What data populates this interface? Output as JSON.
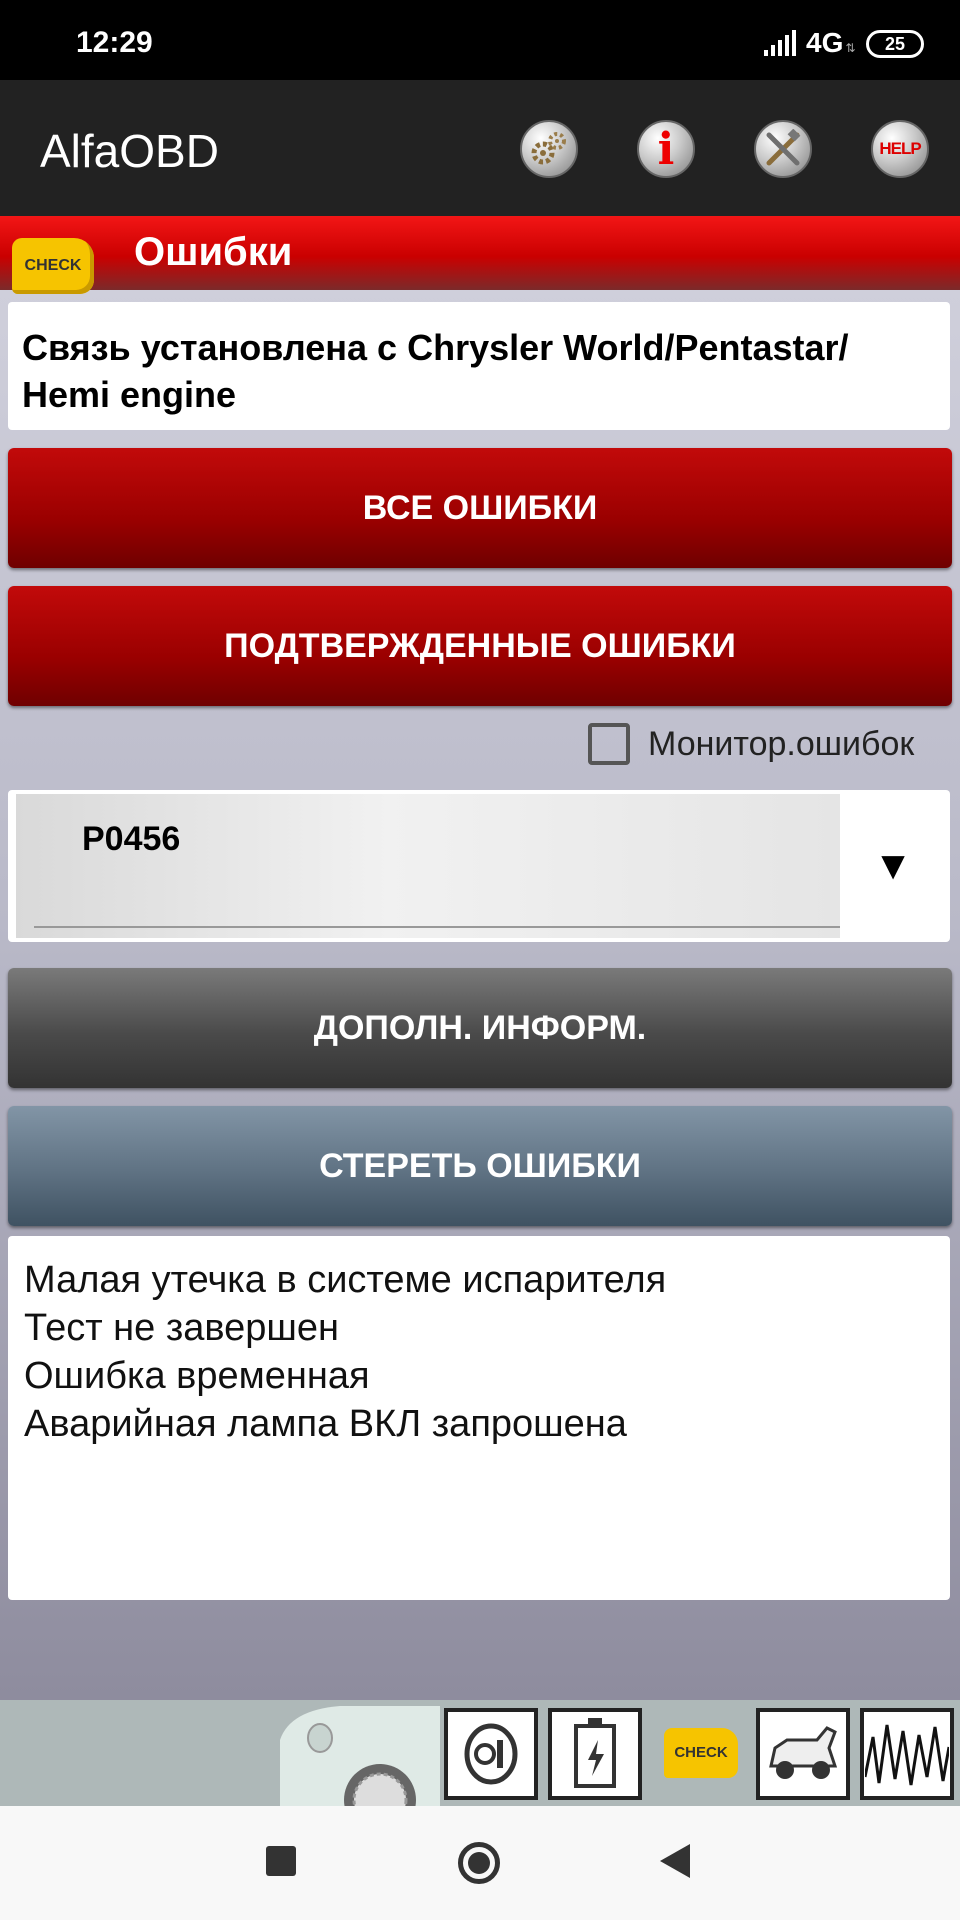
{
  "status_bar": {
    "time": "12:29",
    "network": "4G",
    "battery": "25"
  },
  "app_bar": {
    "title": "AlfaOBD",
    "actions": [
      {
        "icon": "gears-icon"
      },
      {
        "icon": "info-icon",
        "glyph": "i"
      },
      {
        "icon": "tools-icon"
      },
      {
        "icon": "help-icon",
        "glyph": "HELP"
      }
    ]
  },
  "section": {
    "badge": "CHECK",
    "title": "Ошибки"
  },
  "connection_status": "Связь установлена с Chrysler World/Pentastar/ Hemi engine",
  "buttons": {
    "all_errors": "ВСЕ ОШИБКИ",
    "confirmed_errors": "ПОДТВЕРЖДЕННЫЕ ОШИБКИ",
    "more_info": "ДОПОЛН. ИНФОРМ.",
    "clear_errors": "СТЕРЕТЬ ОШИБКИ"
  },
  "monitor": {
    "label": "Монитор.ошибок",
    "checked": false
  },
  "dtc_select": {
    "selected": "P0456",
    "arrow": "▼"
  },
  "description": {
    "lines": [
      "Малая утечка в системе испарителя",
      "Тест не завершен",
      "Ошибка временная",
      "Аварийная лампа ВКЛ запрошена"
    ]
  },
  "toolbar": {
    "check_label": "CHECK"
  },
  "colors": {
    "accent_red": "#c20a0a",
    "check_yellow": "#f6c400"
  }
}
